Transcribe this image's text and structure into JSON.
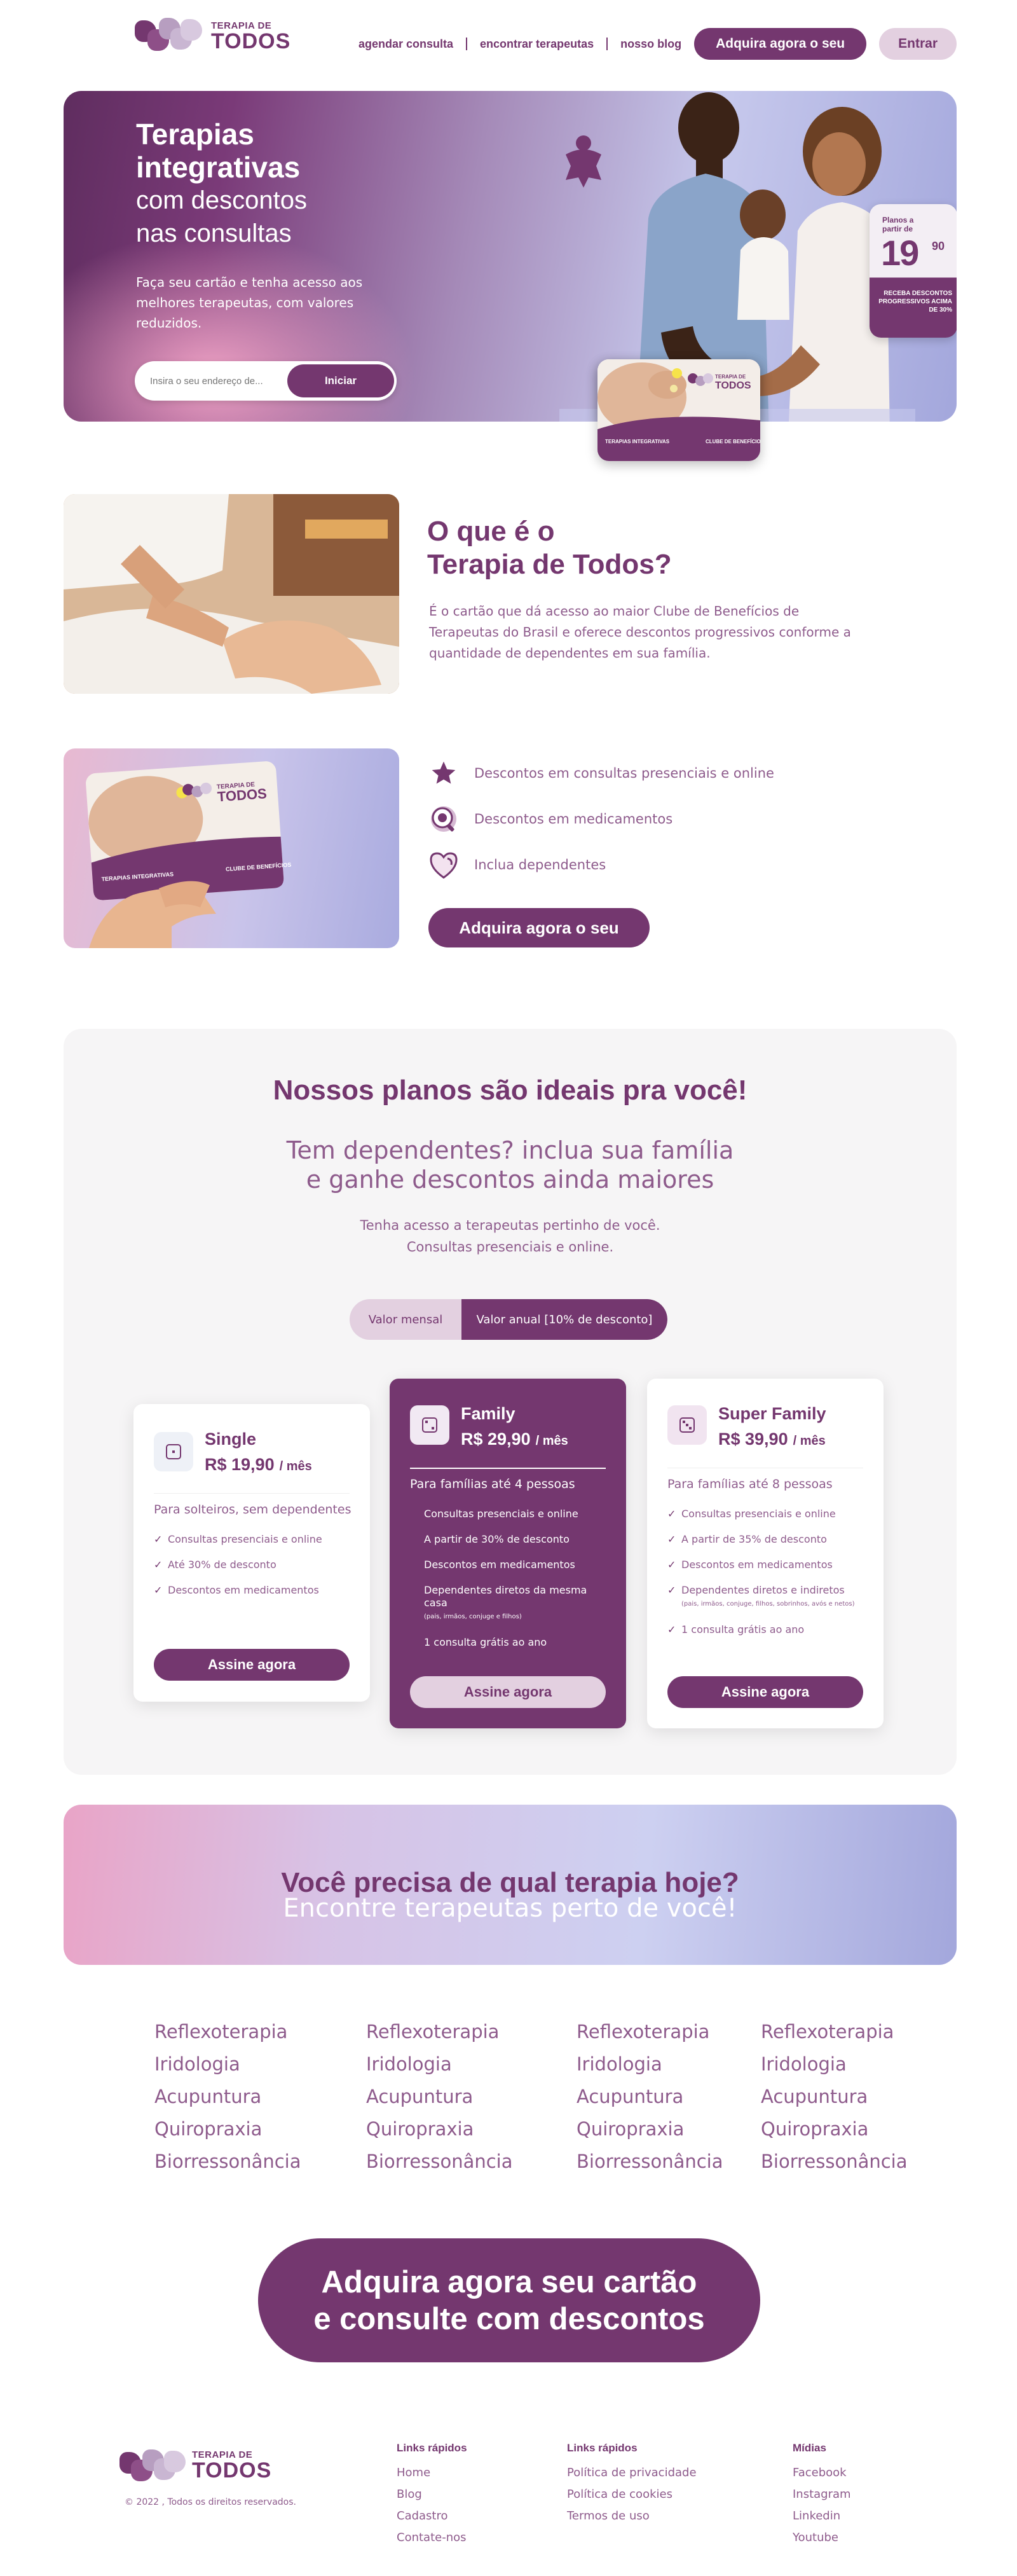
{
  "brand": {
    "logo_small": "TERAPIA DE",
    "logo_big": "TODOS"
  },
  "nav": {
    "links": [
      "agendar consulta",
      "encontrar terapeutas",
      "nosso blog"
    ],
    "cta": "Adquira agora o seu",
    "login": "Entrar"
  },
  "hero": {
    "title_bold_1": "Terapias",
    "title_bold_2": "integrativas",
    "title_light_1": "com descontos",
    "title_light_2": "nas consultas",
    "subtitle": "Faça seu cartão e tenha acesso aos melhores terapeutas, com valores reduzidos.",
    "search_placeholder": "Insira o seu endereço de...",
    "search_button": "Iniciar",
    "badge_label": "Planos a partir de",
    "badge_price": "19",
    "badge_cents": "90",
    "badge_desc": "RECEBA DESCONTOS PROGRESSIVOS ACIMA DE 30%",
    "card_small_label": "TERAPIAS INTEGRATIVAS",
    "card_small_label2": "CLUBE DE BENEFÍCIOS"
  },
  "about": {
    "title_line1": "O que é o",
    "title_line2": "Terapia de Todos?",
    "text": "É o cartão que dá acesso ao maior Clube de Benefícios de Terapeutas do Brasil e oferece descontos progressivos conforme a quantidade de dependentes em sua família."
  },
  "benefits": {
    "items": [
      {
        "icon": "star-icon",
        "label": "Descontos em consultas presenciais e online"
      },
      {
        "icon": "medicine-icon",
        "label": "Descontos em medicamentos"
      },
      {
        "icon": "heart-icon",
        "label": "Inclua dependentes"
      }
    ],
    "cta": "Adquira agora o seu"
  },
  "plans": {
    "title": "Nossos planos são ideais pra você!",
    "subtitle_line1": "Tem dependentes? inclua sua família",
    "subtitle_line2": "e ganhe descontos ainda maiores",
    "sub2_line1": "Tenha acesso a terapeutas pertinho de você.",
    "sub2_line2": "Consultas presenciais e online.",
    "toggle_monthly": "Valor mensal",
    "toggle_annual": "Valor anual [10% de desconto]",
    "items": [
      {
        "name": "Single",
        "price": "R$ 19,90",
        "period": "/ mês",
        "desc": "Para solteiros, sem dependentes",
        "features": [
          "Consultas presenciais e online",
          "Até 30% de desconto",
          "Descontos em medicamentos"
        ],
        "button": "Assine agora"
      },
      {
        "name": "Family",
        "price": "R$ 29,90",
        "period": "/ mês",
        "desc": "Para famílias até 4 pessoas",
        "features": [
          "Consultas presenciais e online",
          "A partir de 30% de desconto",
          "Descontos em medicamentos",
          "Dependentes diretos da mesma casa",
          "1 consulta grátis ao ano"
        ],
        "feature_note": "(pais, irmãos, conjuge e filhos)",
        "button": "Assine agora"
      },
      {
        "name": "Super Family",
        "price": "R$ 39,90",
        "period": "/ mês",
        "desc": "Para famílias até 8 pessoas",
        "features": [
          "Consultas presenciais e online",
          "A partir de 35% de desconto",
          "Descontos em medicamentos",
          "Dependentes diretos e indiretos",
          "1 consulta grátis ao ano"
        ],
        "feature_note": "(pais, irmãos, conjuge, filhos, sobrinhos, avós e netos)",
        "button": "Assine agora"
      }
    ]
  },
  "banner": {
    "title": "Você precisa de qual terapia hoje?",
    "subtitle": "Encontre terapeutas perto de você!"
  },
  "therapies": {
    "columns": [
      [
        "Reflexoterapia",
        "Iridologia",
        "Acupuntura",
        "Quiropraxia",
        "Biorressonância"
      ],
      [
        "Reflexoterapia",
        "Iridologia",
        "Acupuntura",
        "Quiropraxia",
        "Biorressonância"
      ],
      [
        "Reflexoterapia",
        "Iridologia",
        "Acupuntura",
        "Quiropraxia",
        "Biorressonância"
      ],
      [
        "Reflexoterapia",
        "Iridologia",
        "Acupuntura",
        "Quiropraxia",
        "Biorressonância"
      ]
    ]
  },
  "big_cta": {
    "line1": "Adquira agora seu cartão",
    "line2": "e consulte com descontos"
  },
  "footer": {
    "copyright": "© 2022 , Todos os direitos reservados.",
    "col1": {
      "title": "Links rápidos",
      "links": [
        "Home",
        "Blog",
        "Cadastro",
        "Contate-nos"
      ]
    },
    "col2": {
      "title": "Links rápidos",
      "links": [
        "Política de privacidade",
        "Política de cookies",
        "Termos de uso"
      ]
    },
    "col3": {
      "title": "Mídias",
      "links": [
        "Facebook",
        "Instagram",
        "Linkedin",
        "Youtube"
      ]
    }
  },
  "colors": {
    "primary": "#74376f",
    "light": "#e3d0e0",
    "text": "#8e5b8c"
  }
}
